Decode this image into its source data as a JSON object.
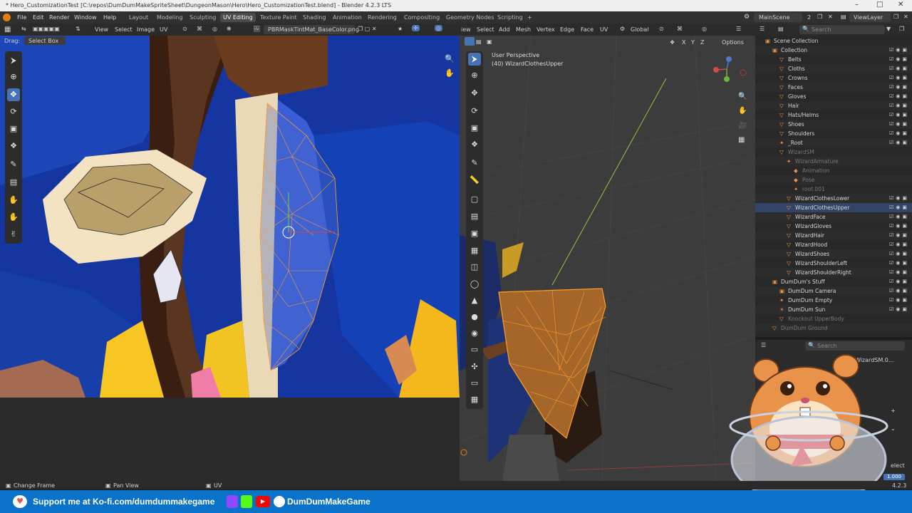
{
  "window": {
    "title": "* Hero_CustomizationTest [C:\\repos\\DumDumMakeSpriteSheet\\DungeonMason\\Hero\\Hero_CustomizationTest.blend] - Blender 4.2.3 LTS",
    "minimize": "–",
    "maximize": "□",
    "close": "✕"
  },
  "menu": [
    "File",
    "Edit",
    "Render",
    "Window",
    "Help"
  ],
  "workspaces": [
    "Layout",
    "Modeling",
    "Sculpting",
    "UV Editing",
    "Texture Paint",
    "Shading",
    "Animation",
    "Rendering",
    "Compositing",
    "Geometry Nodes",
    "Scripting",
    "+"
  ],
  "scene": {
    "name": "MainScene",
    "users": "2",
    "view_layer": "ViewLayer"
  },
  "uv_editor": {
    "menus": [
      "View",
      "Select",
      "Image",
      "UV"
    ],
    "image_name": "PBRMaskTintMat_BaseColor.png",
    "drag_label": "Drag:",
    "drag_value": "Select Box"
  },
  "viewport": {
    "menus": [
      "iew",
      "Select",
      "Add",
      "Mesh",
      "Vertex",
      "Edge",
      "Face",
      "UV"
    ],
    "orientation": "Global",
    "axes": [
      "X",
      "Y",
      "Z"
    ],
    "options": "Options",
    "perspective": "User Perspective",
    "object": "(40) WizardClothesUpper"
  },
  "outliner": {
    "search_placeholder": "Search",
    "rows": [
      {
        "label": "Scene Collection",
        "style": "normal"
      },
      {
        "label": "Collection",
        "style": "normal"
      },
      {
        "label": "Belts",
        "style": "normal"
      },
      {
        "label": "Cloths",
        "style": "normal"
      },
      {
        "label": "Crowns",
        "style": "normal"
      },
      {
        "label": "Faces",
        "style": "normal"
      },
      {
        "label": "Gloves",
        "style": "normal"
      },
      {
        "label": "Hair",
        "style": "normal"
      },
      {
        "label": "Hats/Helms",
        "style": "normal"
      },
      {
        "label": "Shoes",
        "style": "normal"
      },
      {
        "label": "Shoulders",
        "style": "normal"
      },
      {
        "label": "_Root",
        "style": "normal"
      },
      {
        "label": "WizardSM",
        "style": "dim"
      },
      {
        "label": "WizardArmature",
        "style": "dim"
      },
      {
        "label": "Animation",
        "style": "dim"
      },
      {
        "label": "Pose",
        "style": "dim"
      },
      {
        "label": "root.001",
        "style": "dim"
      },
      {
        "label": "WizardClothesLower",
        "style": "normal"
      },
      {
        "label": "WizardClothesUpper",
        "style": "normal"
      },
      {
        "label": "WizardFace",
        "style": "normal"
      },
      {
        "label": "WizardGloves",
        "style": "normal"
      },
      {
        "label": "WizardHair",
        "style": "normal"
      },
      {
        "label": "WizardHood",
        "style": "normal"
      },
      {
        "label": "WizardShoes",
        "style": "normal"
      },
      {
        "label": "WizardShoulderLeft",
        "style": "normal"
      },
      {
        "label": "WizardShoulderRight",
        "style": "normal"
      },
      {
        "label": "DumDum's Stuff",
        "style": "normal"
      },
      {
        "label": "DumDum Camera",
        "style": "normal"
      },
      {
        "label": "DumDum Empty",
        "style": "normal"
      },
      {
        "label": "DumDum Sun",
        "style": "normal"
      },
      {
        "label": "Knockout UpperBody",
        "style": "dim"
      },
      {
        "label": "DumDum Ground",
        "style": "dim"
      }
    ]
  },
  "properties": {
    "search_placeholder": "Search",
    "object_name": "WizardSM.0...",
    "value": "1.000",
    "select_label": "elect"
  },
  "status": {
    "items": [
      "Change Frame",
      "Pan View",
      "UV"
    ],
    "version": "4.2.3"
  },
  "support_banner": {
    "text": "Support me at Ko-fi.com/dumdummakegame",
    "channel": "DumDumMakeGame"
  },
  "colors": {
    "accent_blue": "#4772b3",
    "banner_blue": "#0b72c9",
    "wire_orange": "#ff9c2a",
    "axis_green": "#8fc43f"
  }
}
